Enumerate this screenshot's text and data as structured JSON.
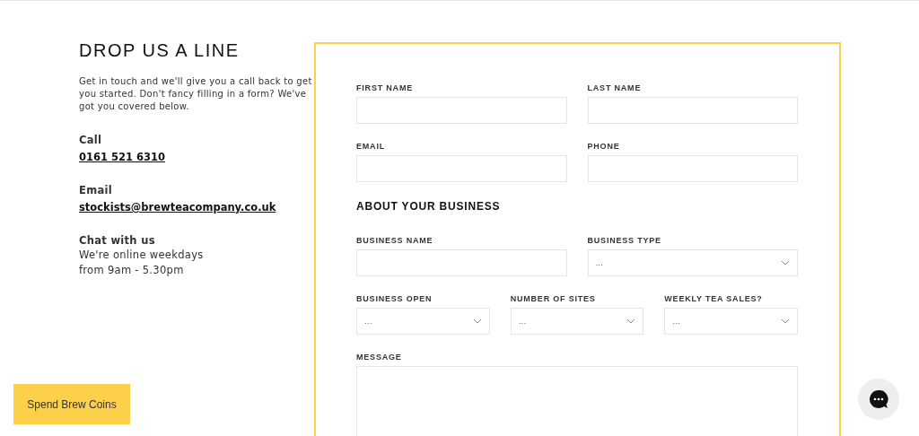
{
  "contact": {
    "heading": "DROP US A LINE",
    "intro": "Get in touch and we'll give you a call back to get you started. Don't fancy filling in a form? We've got you covered below.",
    "items": [
      {
        "label": "Call",
        "value": "0161 521 6310",
        "kind": "link"
      },
      {
        "label": "Email",
        "value": "stockists@brewteacompany.co.uk",
        "kind": "link"
      },
      {
        "label": "Chat with us",
        "value": "We're online weekdays from 9am - 5.30pm",
        "kind": "text"
      }
    ]
  },
  "form": {
    "items": [
      {
        "kind": "row",
        "fields": [
          {
            "kind": "text",
            "label": "FIRST NAME"
          },
          {
            "kind": "text",
            "label": "LAST NAME"
          }
        ]
      },
      {
        "kind": "row",
        "fields": [
          {
            "kind": "text",
            "label": "EMAIL"
          },
          {
            "kind": "text",
            "label": "PHONE"
          }
        ]
      },
      {
        "kind": "heading",
        "text": "ABOUT YOUR BUSINESS"
      },
      {
        "kind": "row",
        "fields": [
          {
            "kind": "text",
            "label": "BUSINESS NAME"
          },
          {
            "kind": "select",
            "label": "BUSINESS TYPE",
            "value": "..."
          }
        ]
      },
      {
        "kind": "row",
        "fields": [
          {
            "kind": "select",
            "label": "BUSINESS OPEN",
            "value": "..."
          },
          {
            "kind": "select",
            "label": "NUMBER OF SITES",
            "value": "..."
          },
          {
            "kind": "select",
            "label": "WEEKLY TEA SALES?",
            "value": "..."
          }
        ]
      },
      {
        "kind": "row",
        "fields": [
          {
            "kind": "textarea",
            "label": "MESSAGE"
          }
        ]
      }
    ]
  },
  "coins_button": "Spend Brew Coins"
}
